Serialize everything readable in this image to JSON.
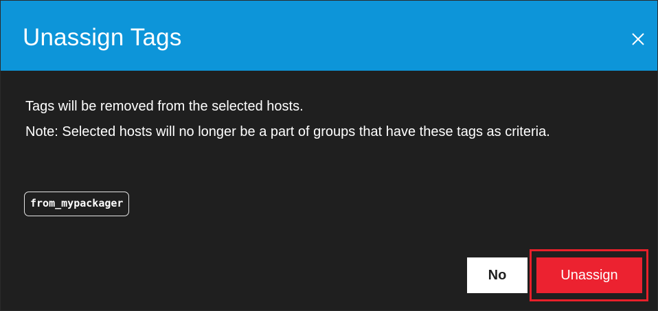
{
  "dialog": {
    "title": "Unassign Tags",
    "close_icon": "close-icon",
    "message_line1": "Tags will be removed from the selected hosts.",
    "message_line2": "Note: Selected hosts will no longer be a part of groups that have these tags as criteria.",
    "tags": [
      "from_mypackager"
    ],
    "buttons": {
      "no_label": "No",
      "unassign_label": "Unassign"
    }
  },
  "colors": {
    "header": "#0d95d9",
    "background": "#1f1f1f",
    "primary_button": "#ec2230",
    "highlight_outline": "#e8202a"
  }
}
